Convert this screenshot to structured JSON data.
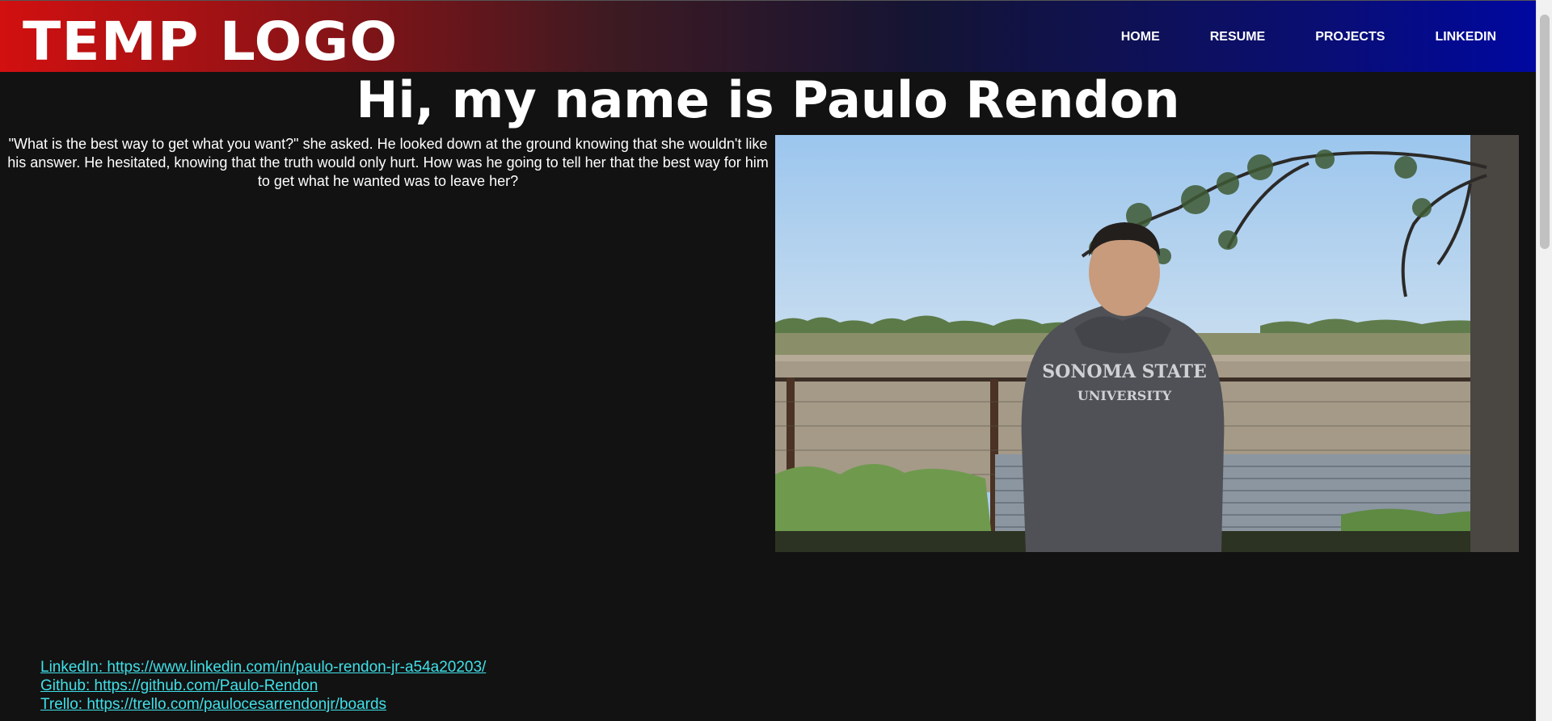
{
  "header": {
    "logo": "TEMP LOGO",
    "nav": [
      "HOME",
      "RESUME",
      "PROJECTS",
      "LINKEDIN"
    ]
  },
  "main": {
    "title": "Hi, my name is Paulo Rendon",
    "quote": "\"What is the best way to get what you want?\" she asked. He looked down at the ground knowing that she wouldn't like his answer. He hesitated, knowing that the truth would only hurt. How was he going to tell her that the best way for him to get what he wanted was to leave her?",
    "photo_shirt_text_1": "SONOMA STATE",
    "photo_shirt_text_2": "UNIVERSITY"
  },
  "links": {
    "linkedin": "LinkedIn: https://www.linkedin.com/in/paulo-rendon-jr-a54a20203/",
    "github": "Github: https://github.com/Paulo-Rendon",
    "trello": "Trello: https://trello.com/paulocesarrendonjr/boards"
  },
  "colors": {
    "background": "#121212",
    "header_left": "#d21010",
    "header_right": "#0008a0",
    "link": "#3fe0e8"
  }
}
